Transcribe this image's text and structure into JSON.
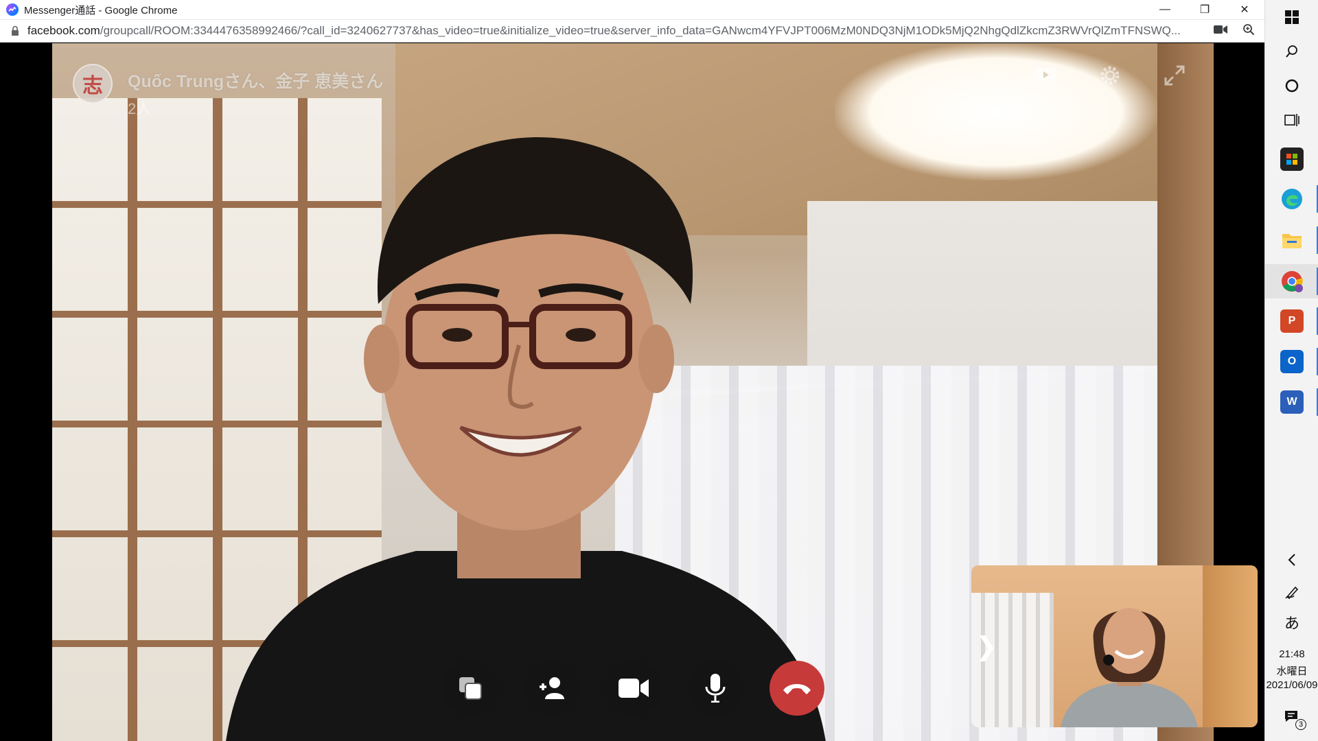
{
  "window": {
    "title": "Messenger通話 - Google Chrome",
    "minimize": "—",
    "restore": "❐",
    "close": "✕"
  },
  "address": {
    "host": "facebook.com",
    "path": "/groupcall/ROOM:3344476358992466/?call_id=3240627737&has_video=true&initialize_video=true&server_info_data=GANwcm4YFVJPT006MzM0NDQ3NjM1ODk5MjQ2NhgQdlZkcmZ3RWVrQlZmTFNSWQ..."
  },
  "call": {
    "participants": "Quốc Trungさん、金子 恵美さん",
    "count": "2人",
    "avatar_glyph": "志"
  },
  "controls": [
    {
      "name": "screen-share-button",
      "icon": "layers-icon"
    },
    {
      "name": "add-person-button",
      "icon": "add-person-icon"
    },
    {
      "name": "camera-button",
      "icon": "video-camera-icon"
    },
    {
      "name": "microphone-button",
      "icon": "microphone-icon"
    },
    {
      "name": "end-call-button",
      "icon": "phone-hangup-icon"
    }
  ],
  "taskbar": {
    "ime": "あ",
    "time": "21:48",
    "weekday": "水曜日",
    "date": "2021/06/09",
    "notification_count": "3"
  },
  "colors": {
    "end_call": "#c73a3a",
    "taskbar_bg": "#f3f3f3",
    "active_indicator": "#3c7bd8"
  }
}
